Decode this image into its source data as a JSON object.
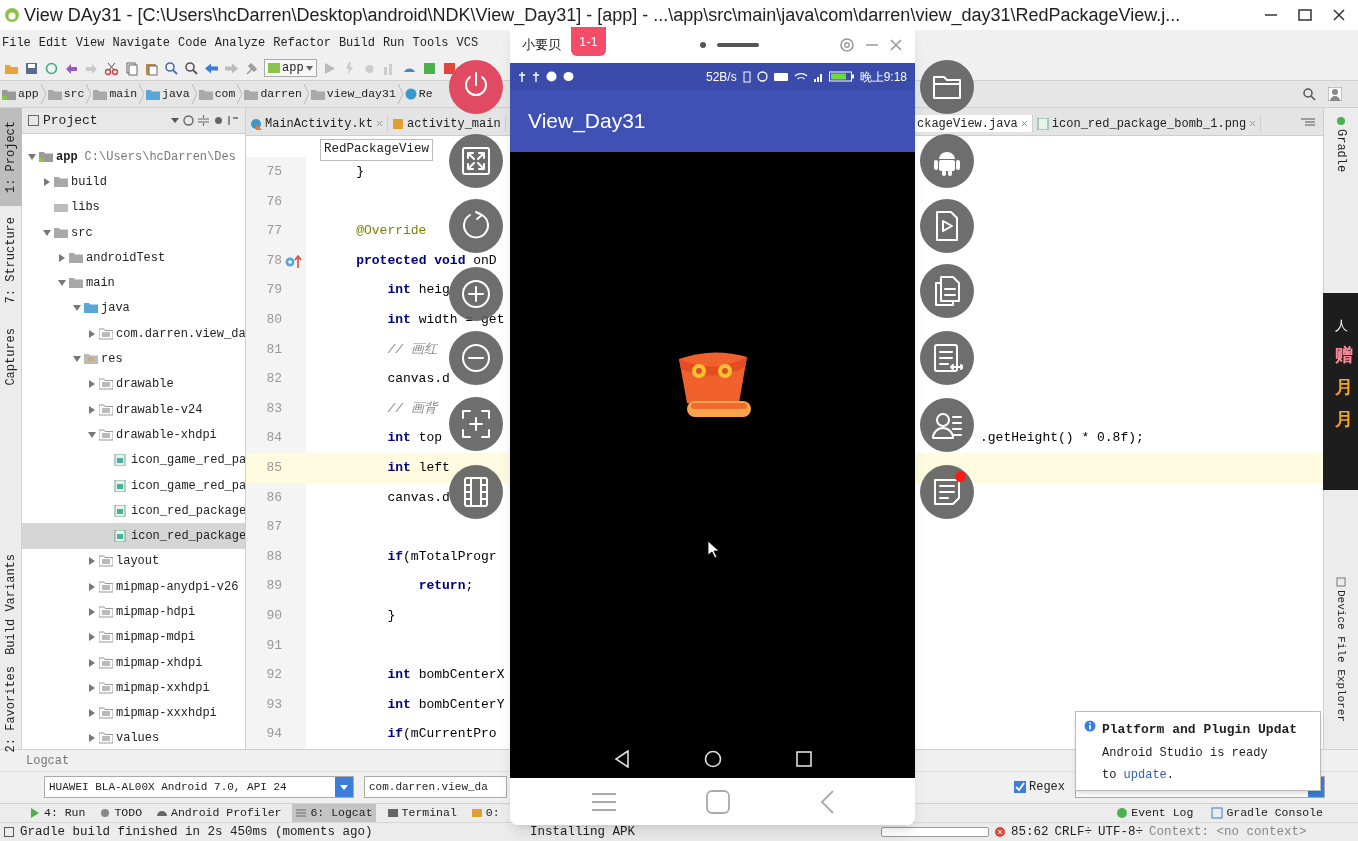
{
  "window": {
    "title": "View DAy31 - [C:\\Users\\hcDarren\\Desktop\\android\\NDK\\View_Day31] - [app] - ...\\app\\src\\main\\java\\com\\darren\\view_day31\\RedPackageView.j..."
  },
  "menu": [
    "File",
    "Edit",
    "View",
    "Navigate",
    "Code",
    "Analyze",
    "Refactor",
    "Build",
    "Run",
    "Tools",
    "VCS"
  ],
  "toolbar": {
    "config": "app"
  },
  "breadcrumbs": [
    {
      "label": "app",
      "kind": "module"
    },
    {
      "label": "src",
      "kind": "folder"
    },
    {
      "label": "main",
      "kind": "folder"
    },
    {
      "label": "java",
      "kind": "source"
    },
    {
      "label": "com",
      "kind": "folder"
    },
    {
      "label": "darren",
      "kind": "folder"
    },
    {
      "label": "view_day31",
      "kind": "folder"
    },
    {
      "label": "Re",
      "kind": "class"
    }
  ],
  "left_stripe": [
    {
      "label": "1: Project",
      "selected": true
    },
    {
      "label": "7: Structure",
      "selected": false
    },
    {
      "label": "Captures",
      "selected": false
    },
    {
      "label": "Build Variants",
      "selected": false
    },
    {
      "label": "2: Favorites",
      "selected": false
    }
  ],
  "project": {
    "title": "Project",
    "tree": [
      {
        "label": "app",
        "path": "C:\\Users\\hcDarren\\Des",
        "kind": "module",
        "expanded": true,
        "selected": false,
        "children": [
          {
            "label": "build",
            "kind": "folder",
            "expanded": false,
            "selected": false
          },
          {
            "label": "libs",
            "kind": "plain",
            "selected": false
          },
          {
            "label": "src",
            "kind": "folder",
            "expanded": true,
            "selected": false,
            "children": [
              {
                "label": "androidTest",
                "kind": "folder",
                "expanded": false,
                "selected": false
              },
              {
                "label": "main",
                "kind": "folder",
                "expanded": true,
                "selected": false,
                "children": [
                  {
                    "label": "java",
                    "kind": "source",
                    "expanded": true,
                    "selected": false,
                    "children": [
                      {
                        "label": "com.darren.view_da",
                        "kind": "package",
                        "expanded": false,
                        "selected": false
                      }
                    ]
                  },
                  {
                    "label": "res",
                    "kind": "resource",
                    "expanded": true,
                    "selected": false,
                    "children": [
                      {
                        "label": "drawable",
                        "kind": "package",
                        "expanded": false,
                        "selected": false
                      },
                      {
                        "label": "drawable-v24",
                        "kind": "package",
                        "expanded": false,
                        "selected": false
                      },
                      {
                        "label": "drawable-xhdpi",
                        "kind": "package",
                        "expanded": true,
                        "selected": false,
                        "children": [
                          {
                            "label": "icon_game_red_pa",
                            "kind": "file",
                            "selected": false
                          },
                          {
                            "label": "icon_game_red_pa",
                            "kind": "file",
                            "selected": false
                          },
                          {
                            "label": "icon_red_package",
                            "kind": "file",
                            "selected": false
                          },
                          {
                            "label": "icon_red_package",
                            "kind": "file",
                            "selected": true
                          }
                        ]
                      },
                      {
                        "label": "layout",
                        "kind": "package",
                        "expanded": false,
                        "selected": false
                      },
                      {
                        "label": "mipmap-anydpi-v26",
                        "kind": "package",
                        "expanded": false,
                        "selected": false
                      },
                      {
                        "label": "mipmap-hdpi",
                        "kind": "package",
                        "expanded": false,
                        "selected": false
                      },
                      {
                        "label": "mipmap-mdpi",
                        "kind": "package",
                        "expanded": false,
                        "selected": false
                      },
                      {
                        "label": "mipmap-xhdpi",
                        "kind": "package",
                        "expanded": false,
                        "selected": false
                      },
                      {
                        "label": "mipmap-xxhdpi",
                        "kind": "package",
                        "expanded": false,
                        "selected": false
                      },
                      {
                        "label": "mipmap-xxxhdpi",
                        "kind": "package",
                        "expanded": false,
                        "selected": false
                      },
                      {
                        "label": "values",
                        "kind": "package",
                        "expanded": false,
                        "selected": false
                      }
                    ]
                  }
                ]
              }
            ]
          }
        ]
      }
    ]
  },
  "editor_tabs": [
    {
      "label": "MainActivity.kt",
      "kind": "kotlin",
      "selected": false
    },
    {
      "label": "activity_main",
      "kind": "xml",
      "selected": false
    },
    {
      "label": "ckageView.java",
      "kind": "java",
      "selected": true
    },
    {
      "label": "icon_red_package_bomb_1.png",
      "kind": "image",
      "selected": false
    }
  ],
  "method_crumbs": [
    "RedPackageView"
  ],
  "code": [
    {
      "number": "75",
      "text": "    }",
      "current": false,
      "overridden": false
    },
    {
      "number": "76",
      "current": false,
      "overridden": false
    },
    {
      "number": "77",
      "text": "    @Override",
      "kind": "annotation",
      "current": false,
      "overridden": false
    },
    {
      "number": "78",
      "text": "    **protected void** onD",
      "current": false,
      "overridden": true
    },
    {
      "number": "79",
      "text": "        **int** heig",
      "current": false,
      "overridden": false
    },
    {
      "number": "80",
      "text": "        **int** width = get",
      "current": false,
      "overridden": false
    },
    {
      "number": "81",
      "text": "        // 画红",
      "kind": "comment",
      "current": false,
      "overridden": false
    },
    {
      "number": "82",
      "text": "        canvas.d",
      "current": false,
      "overridden": false
    },
    {
      "number": "83",
      "text": "        // 画背",
      "kind": "comment",
      "current": false,
      "overridden": false
    },
    {
      "number": "84",
      "text": "        **int** top",
      "tail": ".getHeight() * 0.8f);",
      "current": false,
      "overridden": false
    },
    {
      "number": "85",
      "text": "        **int** left",
      "current": true,
      "overridden": false
    },
    {
      "number": "86",
      "text": "        canvas.d",
      "current": false,
      "overridden": false
    },
    {
      "number": "87",
      "current": false,
      "overridden": false
    },
    {
      "number": "88",
      "text": "        **if**(mTotalProgr",
      "current": false,
      "overridden": false
    },
    {
      "number": "89",
      "text": "            **return**;",
      "current": false,
      "overridden": false
    },
    {
      "number": "90",
      "text": "        }",
      "current": false,
      "overridden": false
    },
    {
      "number": "91",
      "current": false,
      "overridden": false
    },
    {
      "number": "92",
      "text": "        **int** bombCenterX",
      "current": false,
      "overridden": false
    },
    {
      "number": "93",
      "text": "        **int** bombCenterY",
      "current": false,
      "overridden": false
    },
    {
      "number": "94",
      "text": "        **if**(mCurrentPro",
      "current": false,
      "overridden": false
    }
  ],
  "right_stripe": [
    "Gradle",
    "Device File Explorer"
  ],
  "overlay_panel": [
    "人",
    "赠",
    "月",
    "月"
  ],
  "logcat": {
    "title": "Logcat",
    "device": "HUAWEI BLA-AL00X Android 7.0, API 24",
    "process": "com.darren.view_da",
    "regex": {
      "label": "Regex",
      "checked": true
    }
  },
  "tool_windows": [
    {
      "label": "4: Run",
      "selected": false
    },
    {
      "label": "TODO",
      "selected": false
    },
    {
      "label": "Android Profiler",
      "selected": false
    },
    {
      "label": "6: Logcat",
      "selected": true
    },
    {
      "label": "Terminal",
      "selected": false
    },
    {
      "label": "0:",
      "selected": false
    }
  ],
  "tool_windows_right": [
    "Event Log",
    "Gradle Console"
  ],
  "status_bar": {
    "message": "Gradle build finished in 2s 450ms (moments ago)",
    "task": "Installing APK",
    "position": "85:62",
    "line_sep": "CRLF÷",
    "encoding": "UTF-8÷",
    "context": "Context: <no context>"
  },
  "notification": {
    "title": "Platform and Plugin Updat",
    "body": "Android Studio is ready",
    "body2": "to ",
    "link": "update",
    "end": "."
  },
  "emulator": {
    "title": "小要贝",
    "badge": "1-1",
    "speed": "52B/s",
    "time": "晚上9:18",
    "app_title": "View_Day31"
  },
  "float_left": [
    {
      "kind": "power"
    },
    {
      "kind": "fullscreen"
    },
    {
      "kind": "rotate"
    },
    {
      "kind": "zoom-in"
    },
    {
      "kind": "zoom-out"
    },
    {
      "kind": "screenshot"
    },
    {
      "kind": "video"
    }
  ],
  "float_right": [
    {
      "kind": "folder",
      "alert": false
    },
    {
      "kind": "android",
      "alert": false
    },
    {
      "kind": "play-file",
      "alert": false
    },
    {
      "kind": "copy",
      "alert": false
    },
    {
      "kind": "text",
      "alert": false
    },
    {
      "kind": "contacts",
      "alert": false
    },
    {
      "kind": "notes",
      "alert": true
    }
  ]
}
